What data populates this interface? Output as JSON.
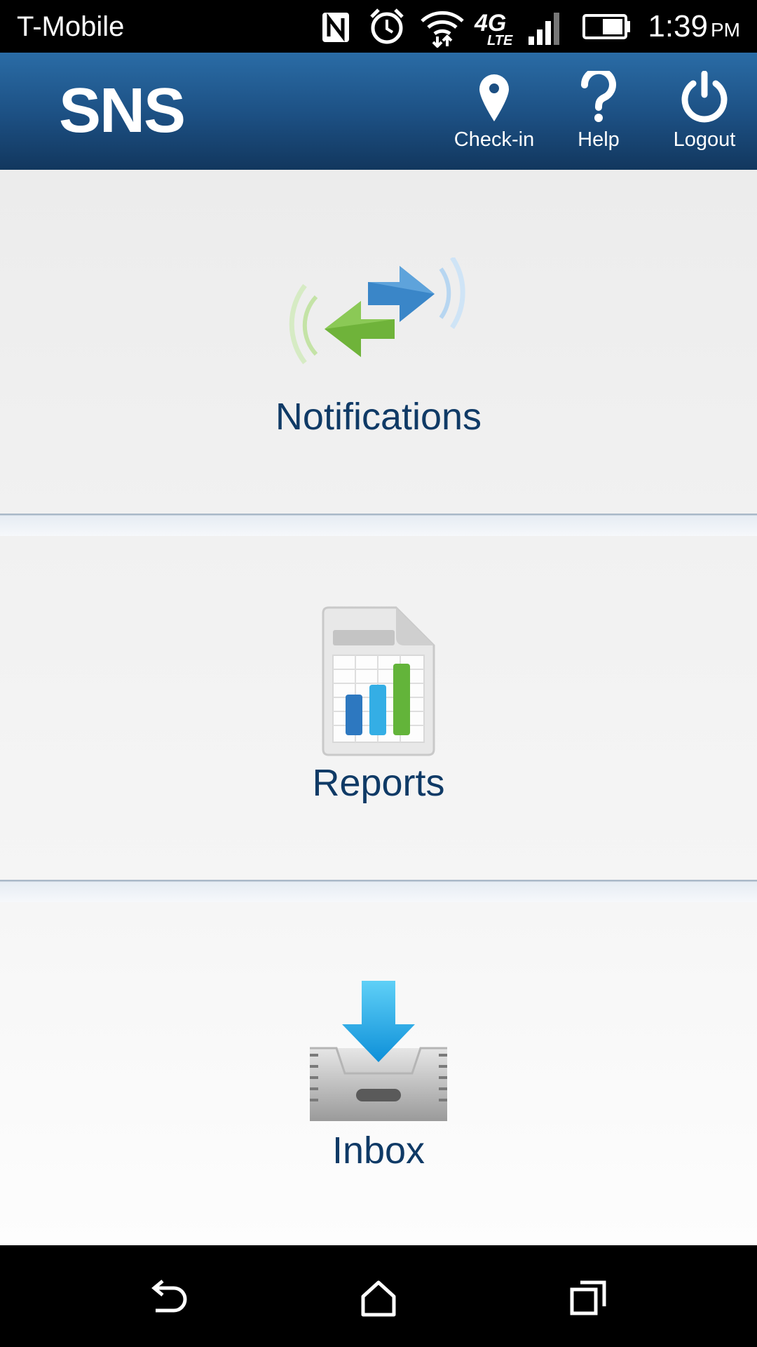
{
  "status_bar": {
    "carrier": "T-Mobile",
    "network": "4G LTE",
    "time": "1:39",
    "ampm": "PM",
    "icons": [
      "nfc-icon",
      "alarm-icon",
      "wifi-icon",
      "4g-lte-icon",
      "signal-icon",
      "battery-icon"
    ]
  },
  "app_bar": {
    "logo": "SNS",
    "actions": [
      {
        "label": "Check-in",
        "icon": "location-pin-icon"
      },
      {
        "label": "Help",
        "icon": "question-mark-icon"
      },
      {
        "label": "Logout",
        "icon": "power-icon"
      }
    ]
  },
  "menu": {
    "items": [
      {
        "label": "Notifications",
        "icon": "notifications-arrows-icon"
      },
      {
        "label": "Reports",
        "icon": "reports-chart-icon"
      },
      {
        "label": "Inbox",
        "icon": "inbox-download-icon"
      }
    ]
  },
  "nav_bar": {
    "buttons": [
      "back-icon",
      "home-icon",
      "recents-icon"
    ]
  },
  "colors": {
    "app_bar_top": "#2a6ca6",
    "app_bar_bottom": "#12375e",
    "tile_label": "#0f3a66",
    "divider": "#a9b8c8"
  }
}
